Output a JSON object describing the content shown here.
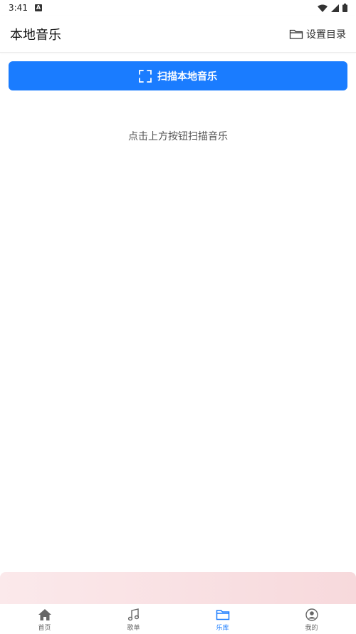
{
  "status_bar": {
    "time": "3:41"
  },
  "header": {
    "title": "本地音乐",
    "set_dir_label": "设置目录"
  },
  "scan_button": {
    "label": "扫描本地音乐"
  },
  "empty_hint": "点击上方按钮扫描音乐",
  "tabbar": {
    "items": [
      {
        "label": "首页",
        "icon": "home-icon"
      },
      {
        "label": "歌单",
        "icon": "music-note-icon"
      },
      {
        "label": "乐库",
        "icon": "folder-icon",
        "active": true
      },
      {
        "label": "我的",
        "icon": "user-icon"
      }
    ]
  },
  "colors": {
    "accent": "#1a7cff",
    "mini_player": "#f7d9dc"
  }
}
